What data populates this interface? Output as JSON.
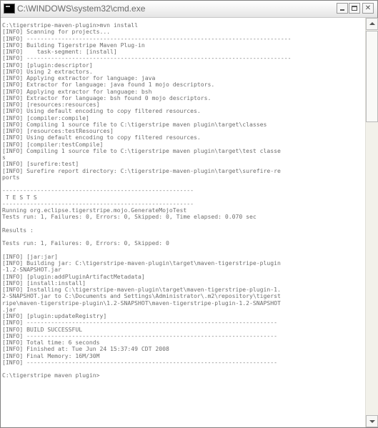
{
  "window": {
    "title": "C:\\WINDOWS\\system32\\cmd.exe",
    "icons": {
      "app": "console-icon",
      "minimize": "minimize-icon",
      "maximize": "maximize-icon",
      "close": "close-icon",
      "scroll_up": "arrow-up-icon",
      "scroll_down": "arrow-down-icon"
    },
    "close_glyph": "✕"
  },
  "console": {
    "lines": [
      "C:\\tigerstripe-maven-plugin>mvn install",
      "[INFO] Scanning for projects...",
      "[INFO] ----------------------------------------------------------------------------",
      "[INFO] Building Tigerstripe Maven Plug-in",
      "[INFO]    task-segment: [install]",
      "[INFO] ----------------------------------------------------------------------------",
      "[INFO] [plugin:descriptor]",
      "[INFO] Using 2 extractors.",
      "[INFO] Applying extractor for language: java",
      "[INFO] Extractor for language: java found 1 mojo descriptors.",
      "[INFO] Applying extractor for language: bsh",
      "[INFO] Extractor for language: bsh found 0 mojo descriptors.",
      "[INFO] [resources:resources]",
      "[INFO] Using default encoding to copy filtered resources.",
      "[INFO] [compiler:compile]",
      "[INFO] Compiling 1 source file to C:\\tigerstripe maven plugin\\target\\classes",
      "[INFO] [resources:testResources]",
      "[INFO] Using default encoding to copy filtered resources.",
      "[INFO] [compiler:testCompile]",
      "[INFO] Compiling 1 source file to C:\\tigerstripe maven plugin\\target\\test classe",
      "s",
      "[INFO] [surefire:test]",
      "[INFO] Surefire report directory: C:\\tigerstripe-maven-plugin\\target\\surefire-re",
      "ports",
      "",
      "-------------------------------------------------------",
      " T E S T S",
      "-------------------------------------------------------",
      "Running org.eclipse.tigerstripe.mojo.GenerateMojoTest",
      "Tests run: 1, Failures: 0, Errors: 0, Skipped: 0, Time elapsed: 0.070 sec",
      "",
      "Results :",
      "",
      "Tests run: 1, Failures: 0, Errors: 0, Skipped: 0",
      "",
      "[INFO] [jar:jar]",
      "[INFO] Building jar: C:\\tigerstripe-maven-plugin\\target\\maven-tigerstripe-plugin",
      "-1.2-SNAPSHOT.jar",
      "[INFO] [plugin:addPluginArtifactMetadata]",
      "[INFO] [install:install]",
      "[INFO] Installing C:\\tigerstripe-maven-plugin\\target\\maven-tigerstripe-plugin-1.",
      "2-SNAPSHOT.jar to C:\\Documents and Settings\\Administrator\\.m2\\repository\\tigerst",
      "ripe\\maven-tigerstripe-plugin\\1.2-SNAPSHOT\\maven-tigerstripe-plugin-1.2-SNAPSHOT",
      ".jar",
      "[INFO] [plugin:updateRegistry]",
      "[INFO] ------------------------------------------------------------------------",
      "[INFO] BUILD SUCCESSFUL",
      "[INFO] ------------------------------------------------------------------------",
      "[INFO] Total time: 6 seconds",
      "[INFO] Finished at: Tue Jun 24 15:37:49 CDT 2008",
      "[INFO] Final Memory: 16M/30M",
      "[INFO] ------------------------------------------------------------------------",
      "",
      "C:\\tigerstripe maven plugin>"
    ]
  }
}
